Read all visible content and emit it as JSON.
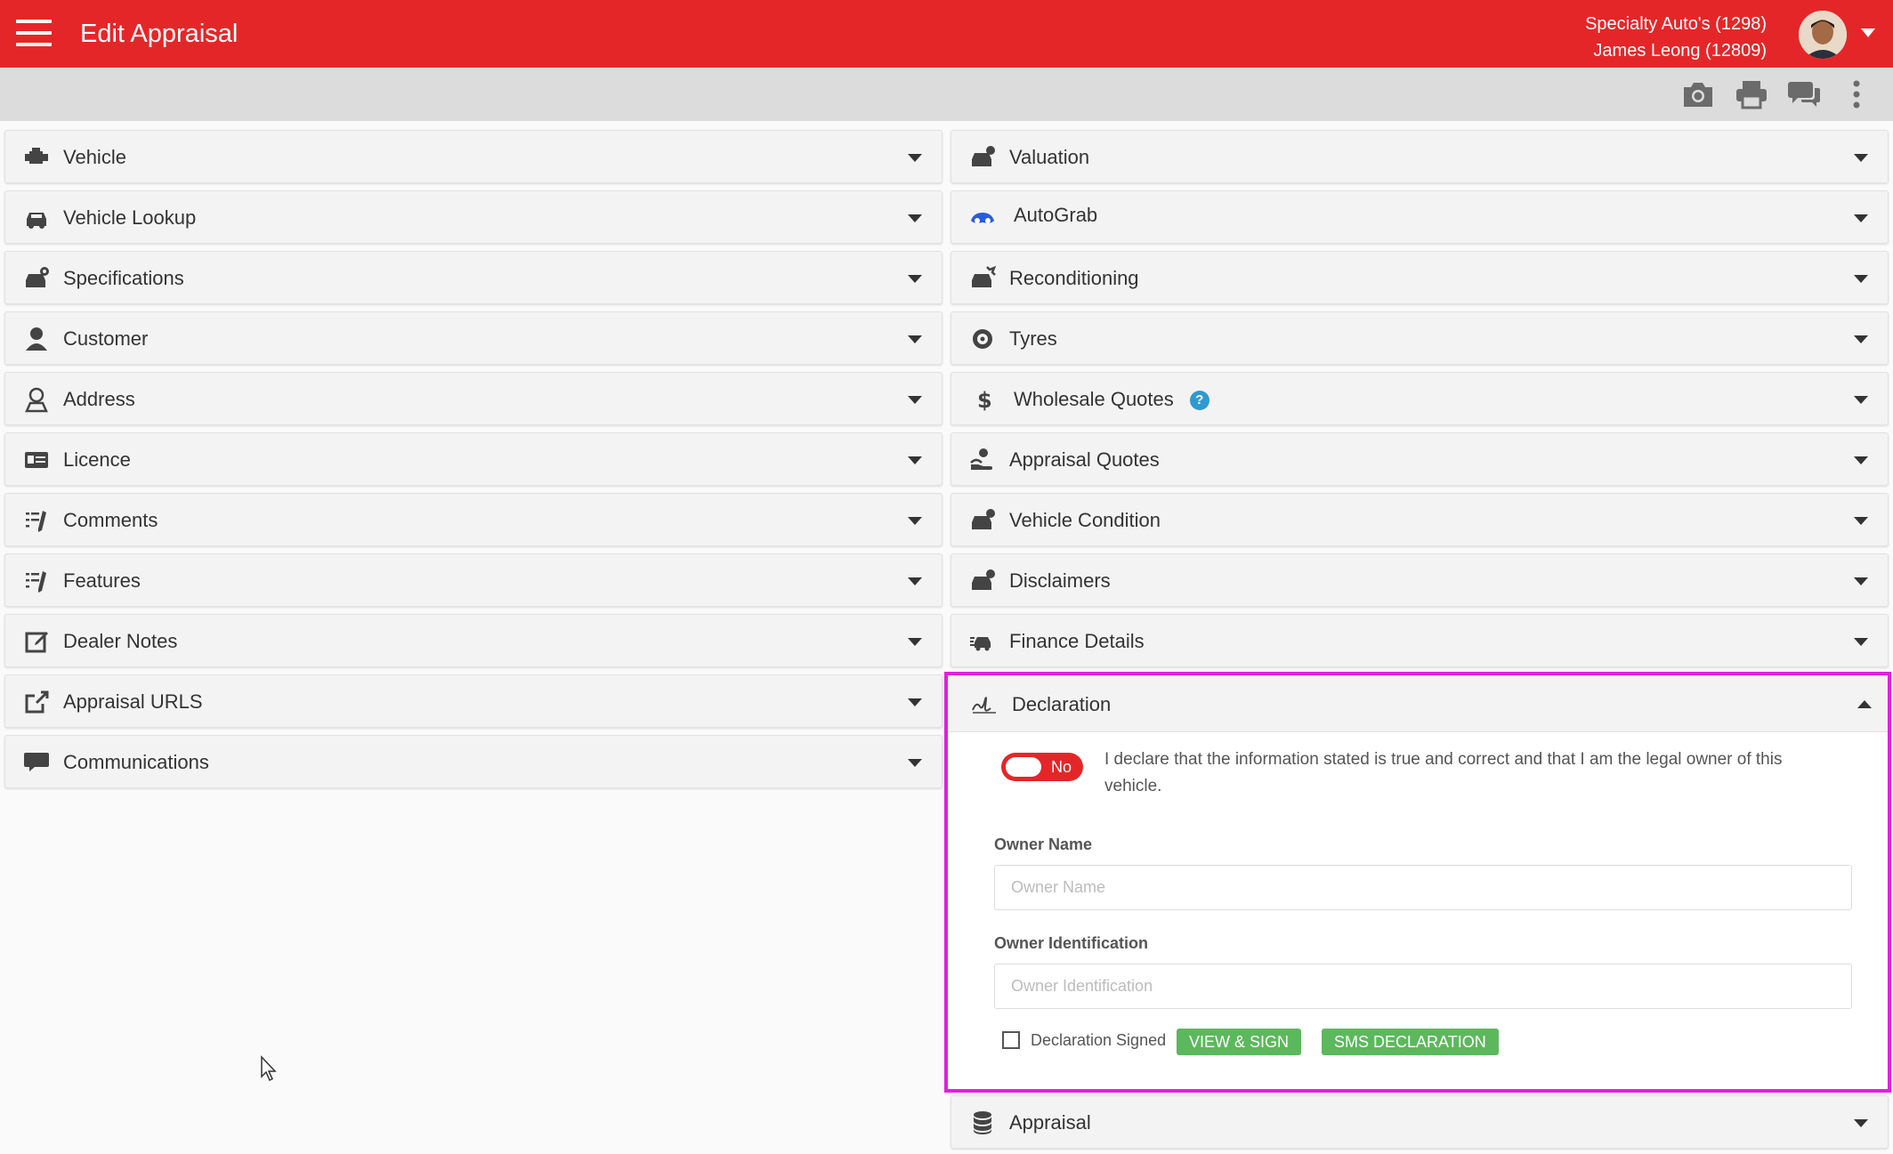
{
  "header": {
    "title": "Edit Appraisal",
    "dealer": "Specialty Auto's (1298)",
    "user": "James Leong (12809)"
  },
  "toolbar": {
    "icons": [
      "camera-icon",
      "print-icon",
      "chat-icon",
      "more-vertical-icon"
    ]
  },
  "left_sections": [
    {
      "label": "Vehicle",
      "icon": "engine-icon"
    },
    {
      "label": "Vehicle Lookup",
      "icon": "car-search-icon"
    },
    {
      "label": "Specifications",
      "icon": "car-cog-icon"
    },
    {
      "label": "Customer",
      "icon": "user-icon"
    },
    {
      "label": "Address",
      "icon": "map-pin-user-icon"
    },
    {
      "label": "Licence",
      "icon": "id-card-icon"
    },
    {
      "label": "Comments",
      "icon": "list-pen-icon"
    },
    {
      "label": "Features",
      "icon": "list-pen-icon"
    },
    {
      "label": "Dealer Notes",
      "icon": "edit-square-icon"
    },
    {
      "label": "Appraisal URLS",
      "icon": "external-link-icon"
    },
    {
      "label": "Communications",
      "icon": "chat-icon"
    }
  ],
  "right_sections": [
    {
      "label": "Valuation",
      "icon": "car-dollar-icon"
    },
    {
      "label": "AutoGrab",
      "icon": "autograb-logo-icon"
    },
    {
      "label": "Reconditioning",
      "icon": "car-wrench-icon"
    },
    {
      "label": "Tyres",
      "icon": "tyre-icon"
    },
    {
      "label": "Wholesale Quotes",
      "icon": "dollar-icon",
      "help": "?"
    },
    {
      "label": "Appraisal Quotes",
      "icon": "hand-coin-icon"
    },
    {
      "label": "Vehicle Condition",
      "icon": "car-check-icon"
    },
    {
      "label": "Disclaimers",
      "icon": "car-alert-icon"
    },
    {
      "label": "Finance Details",
      "icon": "car-finance-icon"
    }
  ],
  "declaration": {
    "label": "Declaration",
    "toggle_label": "No",
    "statement": "I declare that the information stated is true and correct and that I am the legal owner of this vehicle.",
    "owner_name_label": "Owner Name",
    "owner_name_placeholder": "Owner Name",
    "owner_name_value": "",
    "owner_id_label": "Owner Identification",
    "owner_id_placeholder": "Owner Identification",
    "owner_id_value": "",
    "signed_label": "Declaration Signed",
    "view_sign_label": "VIEW & SIGN",
    "sms_label": "SMS DECLARATION"
  },
  "appraisal_section": {
    "label": "Appraisal",
    "icon": "database-icon"
  },
  "colors": {
    "header_red": "#e52628",
    "highlight_magenta": "#e21fdd",
    "button_green": "#5cb85c",
    "help_blue": "#2e9ad0"
  }
}
